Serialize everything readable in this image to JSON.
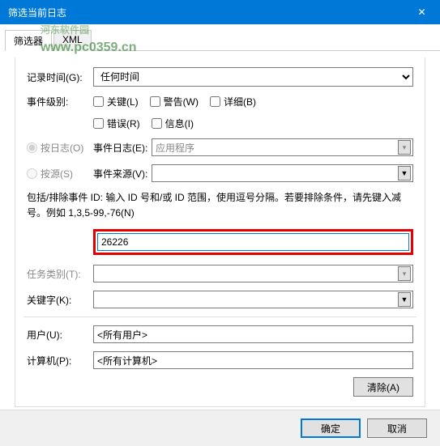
{
  "window": {
    "title": "筛选当前日志"
  },
  "tabs": {
    "filter": "筛选器",
    "xml": "XML"
  },
  "labels": {
    "logTime": "记录时间(G):",
    "level": "事件级别:",
    "byLog": "按日志(O)",
    "bySource": "按源(S)",
    "eventLog": "事件日志(E):",
    "eventSource": "事件来源(V):",
    "eventIdHint": "包括/排除事件 ID: 输入 ID 号和/或 ID 范围，使用逗号分隔。若要排除条件，请先键入减号。例如 1,3,5-99,-76(N)",
    "taskCategory": "任务类别(T):",
    "keyword": "关键字(K):",
    "user": "用户(U):",
    "computer": "计算机(P):"
  },
  "values": {
    "logTime": "任何时间",
    "eventLog": "应用程序",
    "eventSource": "",
    "eventId": "26226",
    "user": "<所有用户>",
    "computer": "<所有计算机>"
  },
  "levels": {
    "critical": "关键(L)",
    "warning": "警告(W)",
    "verbose": "详细(B)",
    "error": "错误(R)",
    "info": "信息(I)"
  },
  "buttons": {
    "clear": "清除(A)",
    "ok": "确定",
    "cancel": "取消"
  },
  "watermark": {
    "line1": "河东软件园",
    "line2": "www.pc0359.cn"
  }
}
